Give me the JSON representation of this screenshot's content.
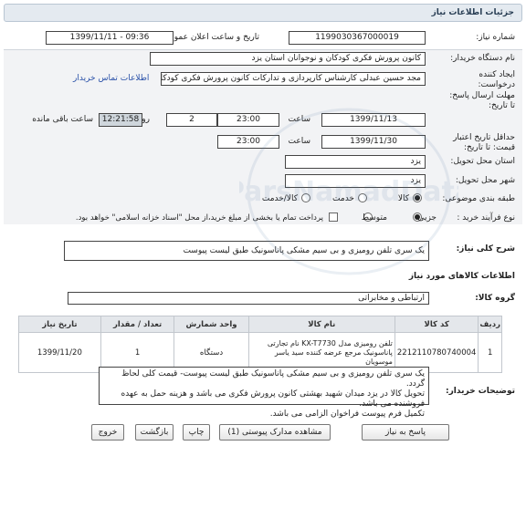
{
  "header": {
    "title": "جزئیات اطلاعات نیاز"
  },
  "fields": {
    "need_number_label": "شماره نیاز:",
    "need_number": "1199030367000019",
    "announce_label": "تاریخ و ساعت اعلان عمومی:",
    "announce_value": "1399/11/11 - 09:36",
    "buyer_label": "نام دستگاه خریدار:",
    "buyer_value": "کانون پرورش فکری کودکان و نوجوانان استان یزد",
    "creator_label_1": "ایجاد کننده",
    "creator_label_2": "درخواست:",
    "creator_value": "مجد حسین عبدلی کارشناس کارپردازی و تدارکات کانون پرورش فکری کودکان و",
    "contact_link": "اطلاعات تماس خریدار",
    "deadline_label_1": "مهلت ارسال پاسخ:",
    "deadline_label_2": "تا تاریخ:",
    "deadline_date": "1399/11/13",
    "time_label": "ساعت",
    "deadline_time": "23:00",
    "days_value": "2",
    "days_label": "روز و",
    "remaining_time": "12:21:58",
    "remaining_label": "ساعت باقی مانده",
    "validity_label_1": "حداقل تاریخ اعتبار",
    "validity_label_2": "قیمت: تا تاریخ:",
    "validity_date": "1399/11/30",
    "validity_time": "23:00",
    "province_label": "استان محل تحویل:",
    "province_value": "یزد",
    "city_label": "شهر محل تحویل:",
    "city_value": "یزد",
    "category_label": "طبقه بندی موضوعی:",
    "category_options": [
      "کالا",
      "خدمت",
      "کالا/خدمت"
    ],
    "process_label": "نوع فرآیند خرید :",
    "process_options": [
      "جزیی",
      "متوسط"
    ],
    "payment_note": "پرداخت تمام یا بخشی از مبلغ خرید،از محل \"اسناد خزانه اسلامی\" خواهد بود."
  },
  "summary": {
    "label": "شرح کلی نیاز:",
    "value": "یک سری تلفن رومیزی و بی سیم مشکی پاناسونیک طبق لیست پیوست"
  },
  "goods": {
    "title": "اطلاعات کالاهای مورد نیاز",
    "group_label": "گروه کالا:",
    "group_value": "ارتباطی و مخابراتی",
    "columns": [
      "ردیف",
      "کد کالا",
      "نام کالا",
      "واحد شمارش",
      "تعداد / مقدار",
      "تاریخ نیاز"
    ],
    "rows": [
      {
        "index": "1",
        "code": "2212110780740004",
        "name": "تلفن رومیزی مدل KX-T7730 نام تجارتی پاناسونیک مرجع عرضه کننده سید یاسر موسویان",
        "unit": "دستگاه",
        "qty": "1",
        "date": "1399/11/20"
      }
    ]
  },
  "buyer_notes": {
    "label": "توضیحات خریدار:",
    "text": "یک سری تلفن رومیزی و بی سیم مشکی پاناسونیک طبق لیست پیوست- قیمت کلی لحاظ گردد.\nتحویل کالا در یزد میدان شهید بهشتی کانون پرورش فکری می باشد و هزینه حمل به عهده فروشنده می باشد.\nتکمیل فرم پیوست فراخوان الزامی می باشد."
  },
  "buttons": {
    "reply": "پاسخ به نیاز",
    "attachments": "مشاهده مدارک پیوستی (1)",
    "print": "چاپ",
    "back": "بازگشت",
    "exit": "خروج"
  },
  "watermark": "ParsNamadData"
}
